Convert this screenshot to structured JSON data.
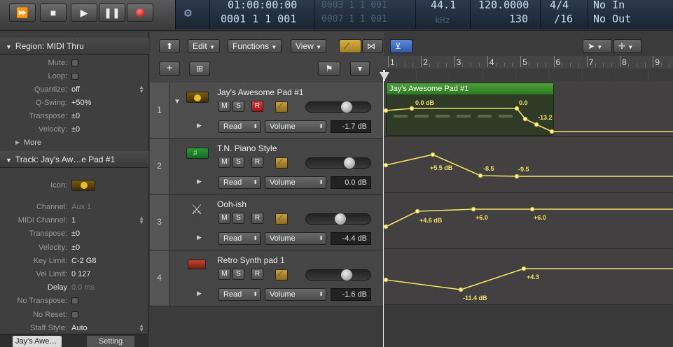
{
  "transport": {
    "position_time": "01:00:00:00",
    "position_bars": "0001 1 1 001",
    "locator_start": "0003 1 1 001",
    "locator_end": "0007 1 1 001",
    "sample_rate": "44.1",
    "sample_rate_unit": "kHz",
    "tempo": "120.0000",
    "tempo_sub": "130",
    "signature": "4/4",
    "division": "/16",
    "midi_in": "No In",
    "midi_out": "No Out"
  },
  "region_inspector": {
    "title": "Region: MIDI Thru",
    "rows": [
      {
        "label": "Mute:",
        "type": "checkbox"
      },
      {
        "label": "Loop:",
        "type": "checkbox"
      },
      {
        "label": "Quantize:",
        "value": "off"
      },
      {
        "label": "Q-Swing:",
        "value": "+50%"
      },
      {
        "label": "Transpose:",
        "value": "±0"
      },
      {
        "label": "Velocity:",
        "value": "±0"
      }
    ],
    "more": "More"
  },
  "track_inspector": {
    "title": "Track:  Jay's Aw…e Pad #1",
    "icon_label": "Icon:",
    "rows": [
      {
        "label": "Channel:",
        "value": "Aux 1",
        "dim": true
      },
      {
        "label": "MIDI Channel:",
        "value": "1"
      },
      {
        "label": "Transpose:",
        "value": "±0"
      },
      {
        "label": "Velocity:",
        "value": "±0"
      },
      {
        "label": "Key Limit:",
        "value": "C-2      G8"
      },
      {
        "label": "Vel Limit:",
        "value": "0      127"
      },
      {
        "label": "Delay",
        "value": "0.0 ms",
        "dim": true
      },
      {
        "label": "No Transpose:",
        "type": "checkbox"
      },
      {
        "label": "No Reset:",
        "type": "checkbox"
      },
      {
        "label": "Staff Style:",
        "value": "Auto"
      }
    ],
    "bottom_tab_1": "Jay's Awe…",
    "bottom_tab_2": "Setting"
  },
  "toolbar": {
    "edit": "Edit",
    "functions": "Functions",
    "view": "View"
  },
  "ruler": [
    "1",
    "2",
    "3",
    "4",
    "5",
    "6",
    "7",
    "8",
    "9"
  ],
  "tracks": [
    {
      "num": "1",
      "name": "Jay's Awesome Pad #1",
      "mode": "Read",
      "param": "Volume",
      "db": "-1.7 dB",
      "fader": 0.64,
      "rec": true
    },
    {
      "num": "2",
      "name": "T.N. Piano Style",
      "mode": "Read",
      "param": "Volume",
      "db": "0.0 dB",
      "fader": 0.7,
      "rec": false
    },
    {
      "num": "3",
      "name": "Ooh-ish",
      "mode": "Read",
      "param": "Volume",
      "db": "-4.4 dB",
      "fader": 0.53,
      "rec": false
    },
    {
      "num": "4",
      "name": "Retro Synth pad 1",
      "mode": "Read",
      "param": "Volume",
      "db": "-1.6 dB",
      "fader": 0.64,
      "rec": false
    }
  ],
  "region": {
    "name": "Jay's Awesome Pad #1"
  },
  "automation_labels": {
    "t1": [
      "0.0 dB",
      "0.0",
      "-13.2"
    ],
    "t2": [
      "+5.5 dB",
      "-8.5",
      "-9.5"
    ],
    "t3": [
      "+4.6 dB",
      "+6.0",
      "+6.0"
    ],
    "t4": [
      "-11.4 dB",
      "+4.3"
    ]
  },
  "colors": {
    "accent": "#f4e266",
    "region": "#3a8a2a"
  }
}
